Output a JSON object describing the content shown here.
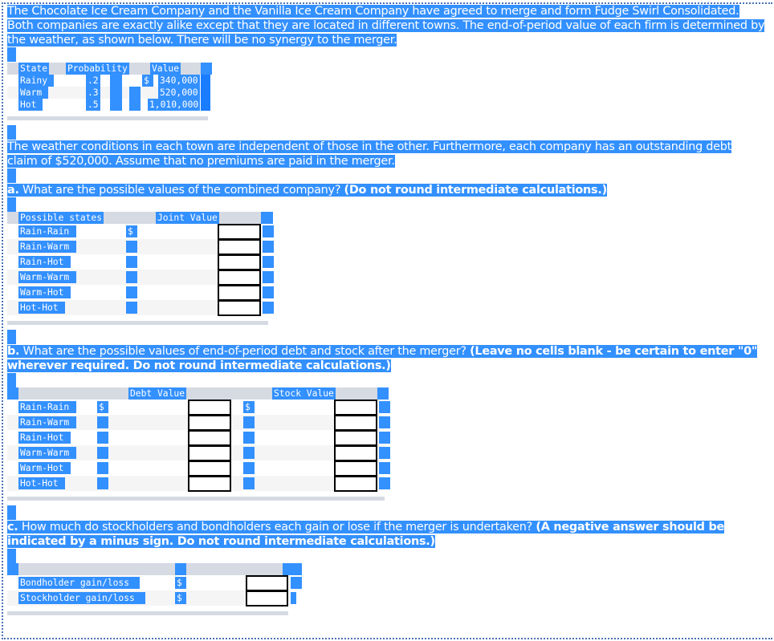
{
  "intro": {
    "lines": [
      "The Chocolate Ice Cream Company and the Vanilla Ice Cream Company have agreed to merge and form Fudge Swirl Consolidated.",
      "Both companies are exactly alike except that they are located in different towns. The end-of-period value of each firm is determined by",
      "the weather, as shown below. There will be no synergy to the merger."
    ]
  },
  "weather_table": {
    "headers": [
      "State",
      "Probability",
      "Value"
    ],
    "currency_symbol": "$",
    "rows": [
      {
        "state": "Rainy",
        "probability": ".2",
        "value": "340,000"
      },
      {
        "state": "Warm",
        "probability": ".3",
        "value": "520,000"
      },
      {
        "state": "Hot",
        "probability": ".5",
        "value": "1,010,000"
      }
    ]
  },
  "context": {
    "lines": [
      "The weather conditions in each town are independent of those in the other. Furthermore, each company has an outstanding debt",
      "claim of $520,000. Assume that no premiums are paid in the merger."
    ]
  },
  "part_a": {
    "prefix": "a.",
    "question": " What are the possible values of the combined company? ",
    "instruction": "(Do not round intermediate calculations.)",
    "headers": [
      "Possible states",
      "Joint Value"
    ],
    "currency_symbol": "$",
    "rows": [
      {
        "state": "Rain-Rain",
        "joint_value": ""
      },
      {
        "state": "Rain-Warm",
        "joint_value": ""
      },
      {
        "state": "Rain-Hot",
        "joint_value": ""
      },
      {
        "state": "Warm-Warm",
        "joint_value": ""
      },
      {
        "state": "Warm-Hot",
        "joint_value": ""
      },
      {
        "state": "Hot-Hot",
        "joint_value": ""
      }
    ]
  },
  "part_b": {
    "prefix": "b.",
    "question": " What are the possible values of end-of-period debt and stock after the merger? ",
    "instruction_line1": "(Leave no cells blank - be certain to enter \"0\"",
    "instruction_line2": "wherever required. Do not round intermediate calculations.)",
    "headers": [
      "Debt Value",
      "Stock Value"
    ],
    "currency_symbol": "$",
    "rows": [
      {
        "state": "Rain-Rain",
        "debt_value": "",
        "stock_value": ""
      },
      {
        "state": "Rain-Warm",
        "debt_value": "",
        "stock_value": ""
      },
      {
        "state": "Rain-Hot",
        "debt_value": "",
        "stock_value": ""
      },
      {
        "state": "Warm-Warm",
        "debt_value": "",
        "stock_value": ""
      },
      {
        "state": "Warm-Hot",
        "debt_value": "",
        "stock_value": ""
      },
      {
        "state": "Hot-Hot",
        "debt_value": "",
        "stock_value": ""
      }
    ]
  },
  "part_c": {
    "prefix": "c.",
    "question": " How much do stockholders and bondholders each gain or lose if the merger is undertaken? ",
    "instruction_line1": "(A negative answer should be",
    "instruction_line2": "indicated by a minus sign. Do not round intermediate calculations.)",
    "currency_symbol": "$",
    "rows": [
      {
        "label": "Bondholder gain/loss",
        "value": ""
      },
      {
        "label": "Stockholder gain/loss",
        "value": ""
      }
    ]
  }
}
